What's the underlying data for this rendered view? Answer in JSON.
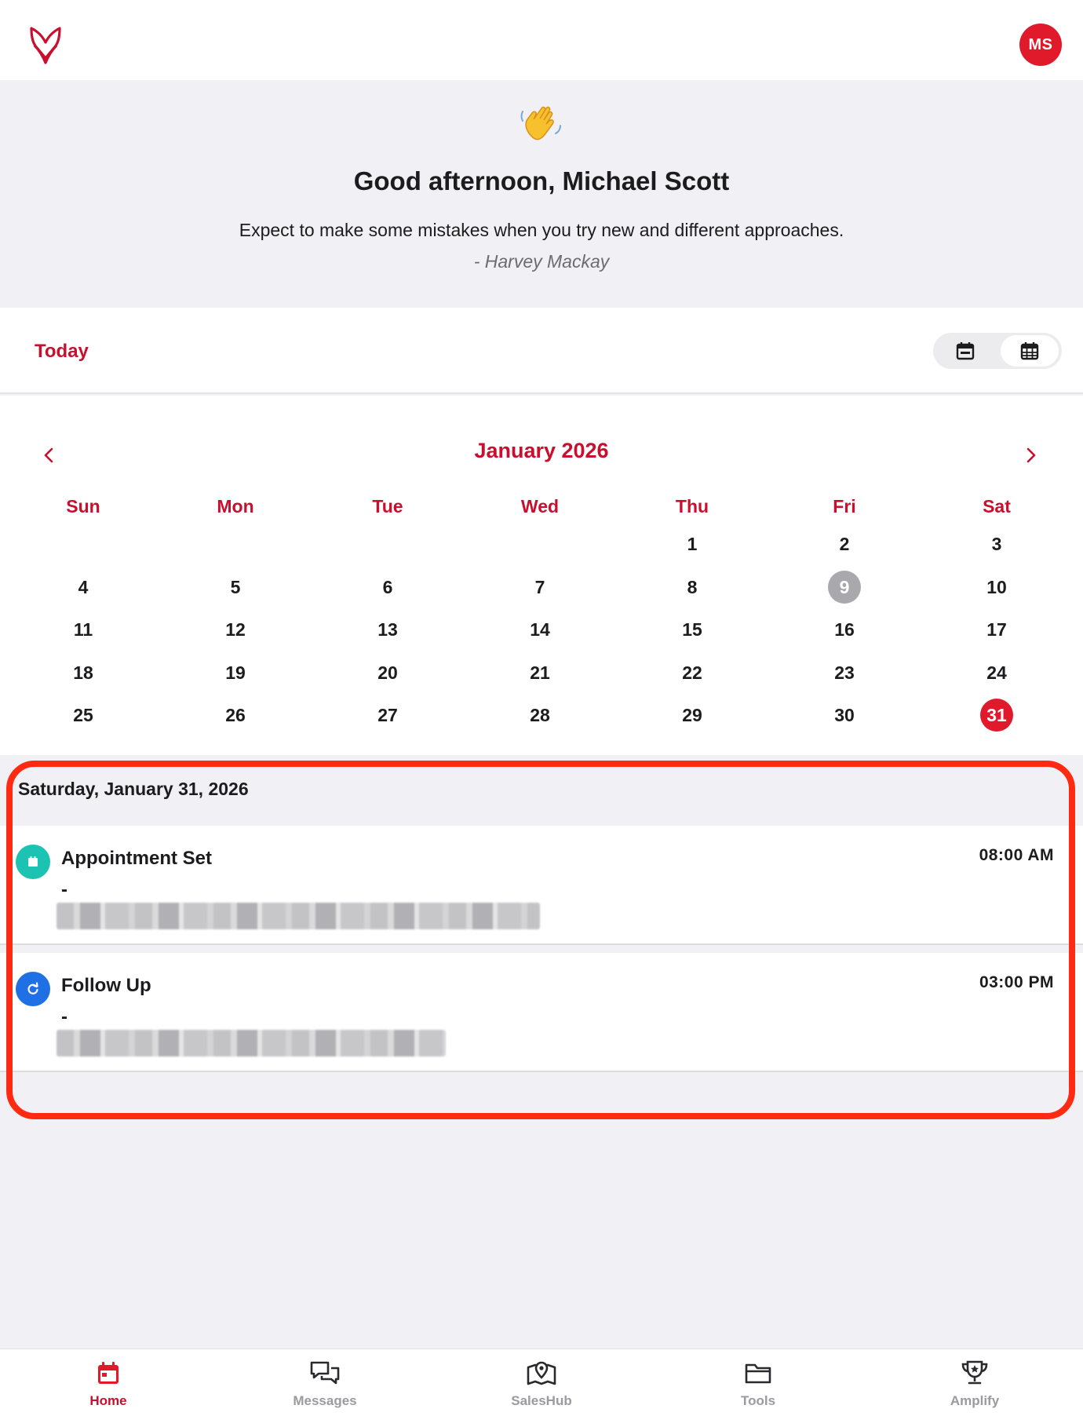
{
  "header": {
    "logo_icon": "brand-logo-icon",
    "avatar_initials": "MS"
  },
  "greeting": {
    "emoji_icon": "waving-hand-icon",
    "title": "Good afternoon, Michael Scott",
    "quote": "Expect to make some mistakes when you try new and different approaches.",
    "author": "- Harvey Mackay"
  },
  "today_bar": {
    "label": "Today",
    "views": [
      {
        "icon": "calendar-day-icon",
        "selected": false
      },
      {
        "icon": "calendar-month-icon",
        "selected": true
      }
    ]
  },
  "calendar": {
    "month_title": "January 2026",
    "weekdays": [
      "Sun",
      "Mon",
      "Tue",
      "Wed",
      "Thu",
      "Fri",
      "Sat"
    ],
    "weeks": [
      [
        "",
        "",
        "",
        "",
        "1",
        "2",
        "3"
      ],
      [
        "4",
        "5",
        "6",
        "7",
        "8",
        "9",
        "10"
      ],
      [
        "11",
        "12",
        "13",
        "14",
        "15",
        "16",
        "17"
      ],
      [
        "18",
        "19",
        "20",
        "21",
        "22",
        "23",
        "24"
      ],
      [
        "25",
        "26",
        "27",
        "28",
        "29",
        "30",
        "31"
      ]
    ],
    "marked_day": "9",
    "selected_day": "31"
  },
  "events": {
    "date_heading": "Saturday, January 31, 2026",
    "items": [
      {
        "title": "Appointment Set",
        "dash": "-",
        "time": "08:00 AM",
        "icon": "calendar-icon",
        "color": "#1cc3b2"
      },
      {
        "title": "Follow Up",
        "dash": "-",
        "time": "03:00 PM",
        "icon": "refresh-icon",
        "color": "#1f6fe5"
      }
    ]
  },
  "tabbar": {
    "tabs": [
      {
        "label": "Home",
        "icon": "home-calendar-icon",
        "active": true
      },
      {
        "label": "Messages",
        "icon": "messages-icon",
        "active": false
      },
      {
        "label": "SalesHub",
        "icon": "map-pin-icon",
        "active": false
      },
      {
        "label": "Tools",
        "icon": "folder-icon",
        "active": false
      },
      {
        "label": "Amplify",
        "icon": "trophy-icon",
        "active": false
      }
    ]
  },
  "colors": {
    "accent": "#c8102e",
    "avatar": "#e0192b",
    "highlight": "#ff2a12"
  }
}
